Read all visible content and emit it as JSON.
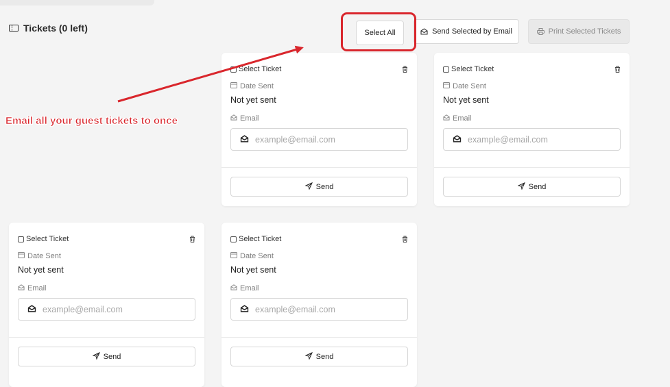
{
  "header": {
    "title": "Tickets (0 left)"
  },
  "toolbar": {
    "select_all_label": "Select All",
    "send_email_label": "Send Selected by Email",
    "print_label": "Print Selected Tickets"
  },
  "annotation": {
    "text": "Email all your guest tickets to once",
    "color": "#d9262c"
  },
  "tickets": [
    {
      "select_label": "Select Ticket",
      "date_label": "Date Sent",
      "date_value": "Not yet sent",
      "email_label": "Email",
      "email_placeholder": "example@email.com",
      "send_label": "Send"
    },
    {
      "select_label": "Select Ticket",
      "date_label": "Date Sent",
      "date_value": "Not yet sent",
      "email_label": "Email",
      "email_placeholder": "example@email.com",
      "send_label": "Send"
    },
    {
      "select_label": "Select Ticket",
      "date_label": "Date Sent",
      "date_value": "Not yet sent",
      "email_label": "Email",
      "email_placeholder": "example@email.com",
      "send_label": "Send"
    },
    {
      "select_label": "Select Ticket",
      "date_label": "Date Sent",
      "date_value": "Not yet sent",
      "email_label": "Email",
      "email_placeholder": "example@email.com",
      "send_label": "Send"
    }
  ],
  "icons": {
    "header": "ticket-icon",
    "send_email": "envelope-open-icon",
    "print": "printer-icon",
    "delete": "trash-icon",
    "calendar": "calendar-icon",
    "email": "envelope-open-icon",
    "send": "paper-plane-icon"
  }
}
